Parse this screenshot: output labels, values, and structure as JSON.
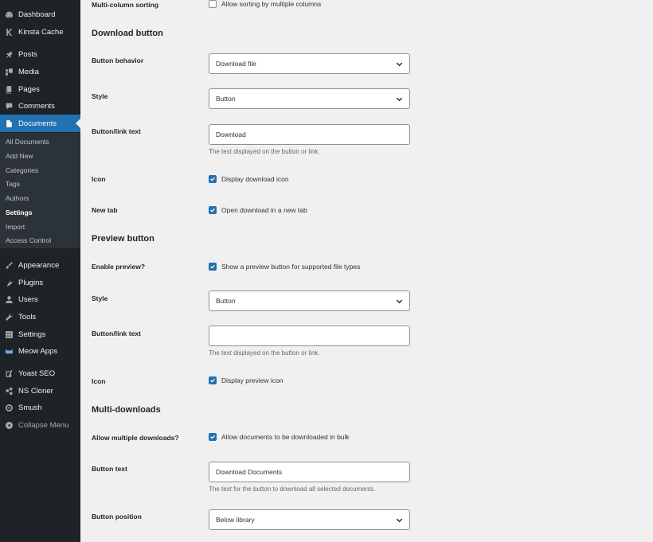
{
  "sidebar": {
    "items_top": [
      {
        "label": "Dashboard",
        "icon": "dashboard-icon"
      },
      {
        "label": "Kinsta Cache",
        "icon": "kinsta-icon"
      }
    ],
    "items_mid": [
      {
        "label": "Posts",
        "icon": "pin-icon"
      },
      {
        "label": "Media",
        "icon": "media-icon"
      },
      {
        "label": "Pages",
        "icon": "pages-icon"
      },
      {
        "label": "Comments",
        "icon": "comments-icon"
      },
      {
        "label": "Documents",
        "icon": "document-icon"
      }
    ],
    "submenu": [
      "All Documents",
      "Add New",
      "Categories",
      "Tags",
      "Authors",
      "Settings",
      "Import",
      "Access Control"
    ],
    "items_lower": [
      {
        "label": "Appearance",
        "icon": "brush-icon"
      },
      {
        "label": "Plugins",
        "icon": "plugin-icon"
      },
      {
        "label": "Users",
        "icon": "users-icon"
      },
      {
        "label": "Tools",
        "icon": "wrench-icon"
      },
      {
        "label": "Settings",
        "icon": "settings-icon"
      },
      {
        "label": "Meow Apps",
        "icon": "meow-icon"
      }
    ],
    "items_bottom": [
      {
        "label": "Yoast SEO",
        "icon": "yoast-icon"
      },
      {
        "label": "NS Cloner",
        "icon": "cloner-icon"
      },
      {
        "label": "Smush",
        "icon": "smush-icon"
      }
    ],
    "collapse_label": "Collapse Menu",
    "colors": {
      "bg": "#1d2327",
      "active": "#2271b1",
      "submenu": "#2c3338"
    }
  },
  "settings": {
    "multi_column": {
      "label": "Multi-column sorting",
      "checkbox": "Allow sorting by multiple columns",
      "checked": false
    },
    "download_section": "Download button",
    "download_behavior": {
      "label": "Button behavior",
      "value": "Download file"
    },
    "download_style": {
      "label": "Style",
      "value": "Button"
    },
    "download_text": {
      "label": "Button/link text",
      "value": "Download",
      "description": "The text displayed on the button or link."
    },
    "download_icon": {
      "label": "Icon",
      "checkbox": "Display download icon",
      "checked": true
    },
    "new_tab": {
      "label": "New tab",
      "checkbox": "Open download in a new tab",
      "checked": true
    },
    "preview_section": "Preview button",
    "enable_preview": {
      "label": "Enable preview?",
      "checkbox": "Show a preview button for supported file types",
      "checked": true
    },
    "preview_style": {
      "label": "Style",
      "value": "Button"
    },
    "preview_text": {
      "label": "Button/link text",
      "value": "",
      "description": "The text displayed on the button or link."
    },
    "preview_icon": {
      "label": "Icon",
      "checkbox": "Display preview icon",
      "checked": true
    },
    "multi_section": "Multi-downloads",
    "allow_multiple": {
      "label": "Allow multiple downloads?",
      "checkbox": "Allow documents to be downloaded in bulk",
      "checked": true
    },
    "button_text": {
      "label": "Button text",
      "value": "Download Documents",
      "description": "The text for the button to download all selected documents."
    },
    "button_position": {
      "label": "Button position",
      "value": "Below library"
    }
  },
  "accent_color": "#2271b1"
}
